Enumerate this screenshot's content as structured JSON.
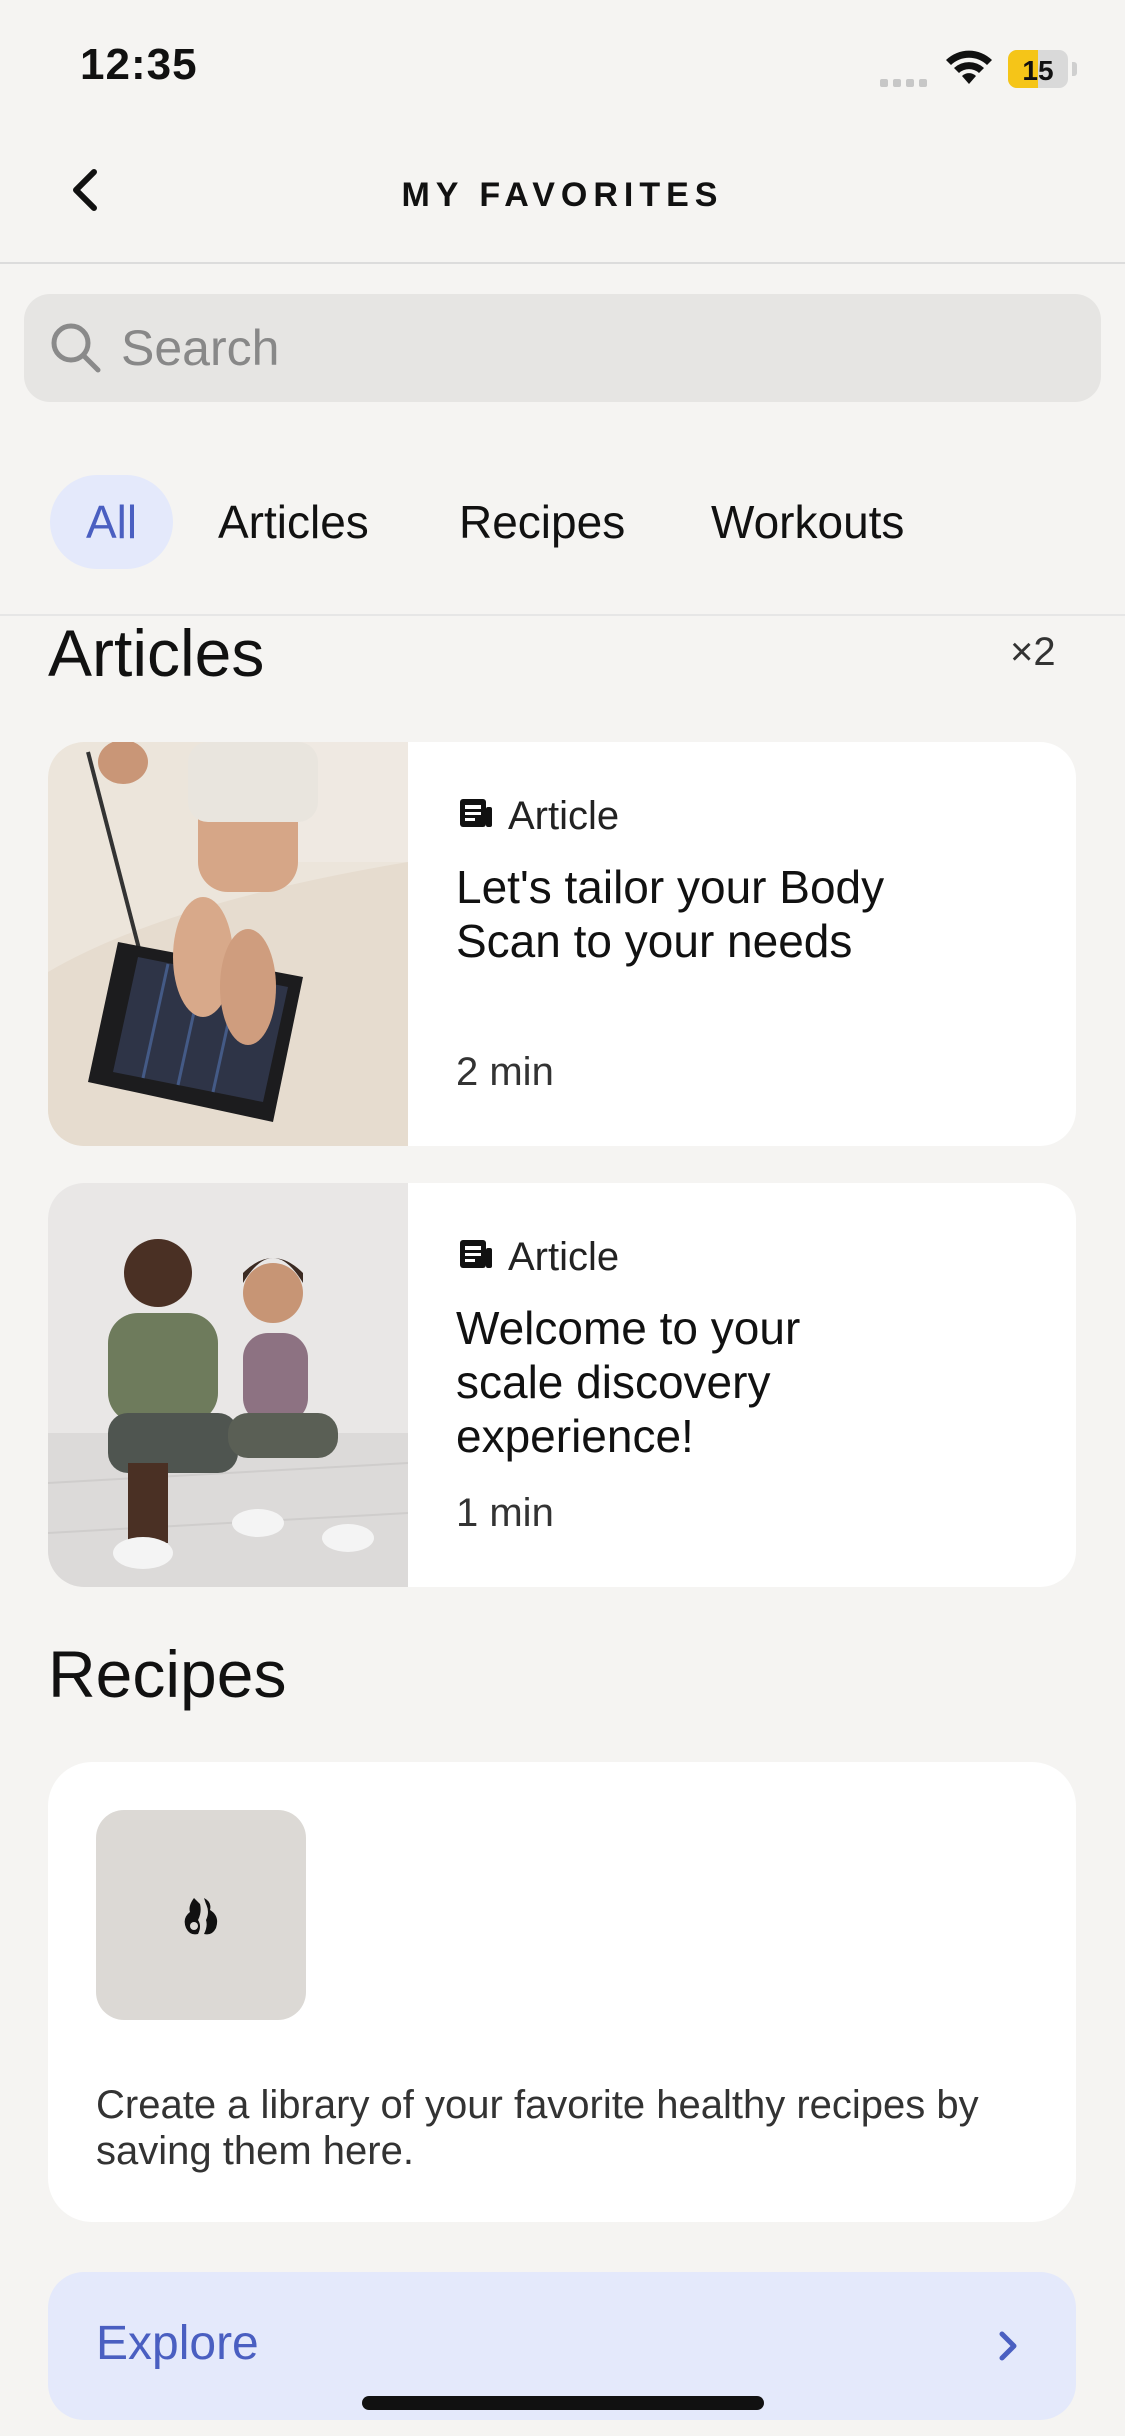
{
  "status_bar": {
    "time": "12:35",
    "battery": "15",
    "battery_level": 0.5
  },
  "header": {
    "title": "MY FAVORITES"
  },
  "search": {
    "placeholder": "Search"
  },
  "tabs": [
    {
      "label": "All",
      "active": true
    },
    {
      "label": "Articles",
      "active": false
    },
    {
      "label": "Recipes",
      "active": false
    },
    {
      "label": "Workouts",
      "active": false
    }
  ],
  "articles": {
    "title": "Articles",
    "count": "×2",
    "items": [
      {
        "type": "Article",
        "title": "Let's tailor your Body Scan to your needs",
        "duration": "2 min"
      },
      {
        "type": "Article",
        "title": "Welcome to your scale discovery experience!",
        "duration": "1 min"
      }
    ]
  },
  "recipes": {
    "title": "Recipes",
    "empty_text": "Create a library of your favorite healthy recipes by saving them here."
  },
  "explore": {
    "label": "Explore"
  },
  "colors": {
    "accent": "#4a5fc1",
    "accent_bg": "#e4e9fb",
    "background": "#f5f4f2"
  }
}
